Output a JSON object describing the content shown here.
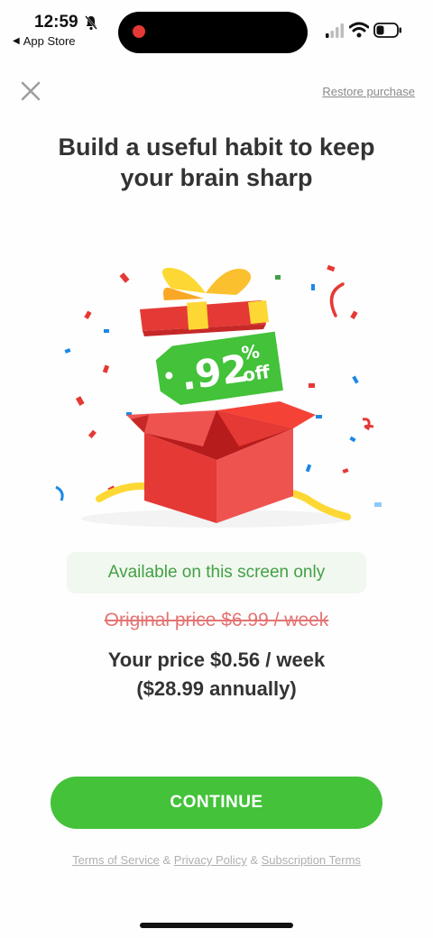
{
  "status_bar": {
    "time": "12:59",
    "back_app": "App Store",
    "back_arrow": "◀"
  },
  "header": {
    "restore_label": "Restore purchase"
  },
  "headline": {
    "line1": "Build a useful habit to keep",
    "line2": "your brain sharp"
  },
  "badge": {
    "value": ".92",
    "percent": "%",
    "off": "off"
  },
  "offer": {
    "available_label": "Available on this screen only",
    "original_price": "Original price $6.99 / week",
    "your_price_line1": "Your price $0.56 / week",
    "your_price_line2": "($28.99 annually)"
  },
  "cta": {
    "continue_label": "CONTINUE"
  },
  "legal": {
    "terms": "Terms of Service",
    "sep1": " & ",
    "privacy": "Privacy Policy",
    "sep2": " & ",
    "subscription": "Subscription Terms"
  },
  "colors": {
    "accent_green": "#43c23a",
    "gift_red": "#e53935",
    "ribbon_yellow": "#fdd835",
    "strike_red": "#e57373"
  },
  "icons": [
    "bell-slash-icon",
    "signal-icon",
    "wifi-icon",
    "battery-icon",
    "close-icon"
  ]
}
